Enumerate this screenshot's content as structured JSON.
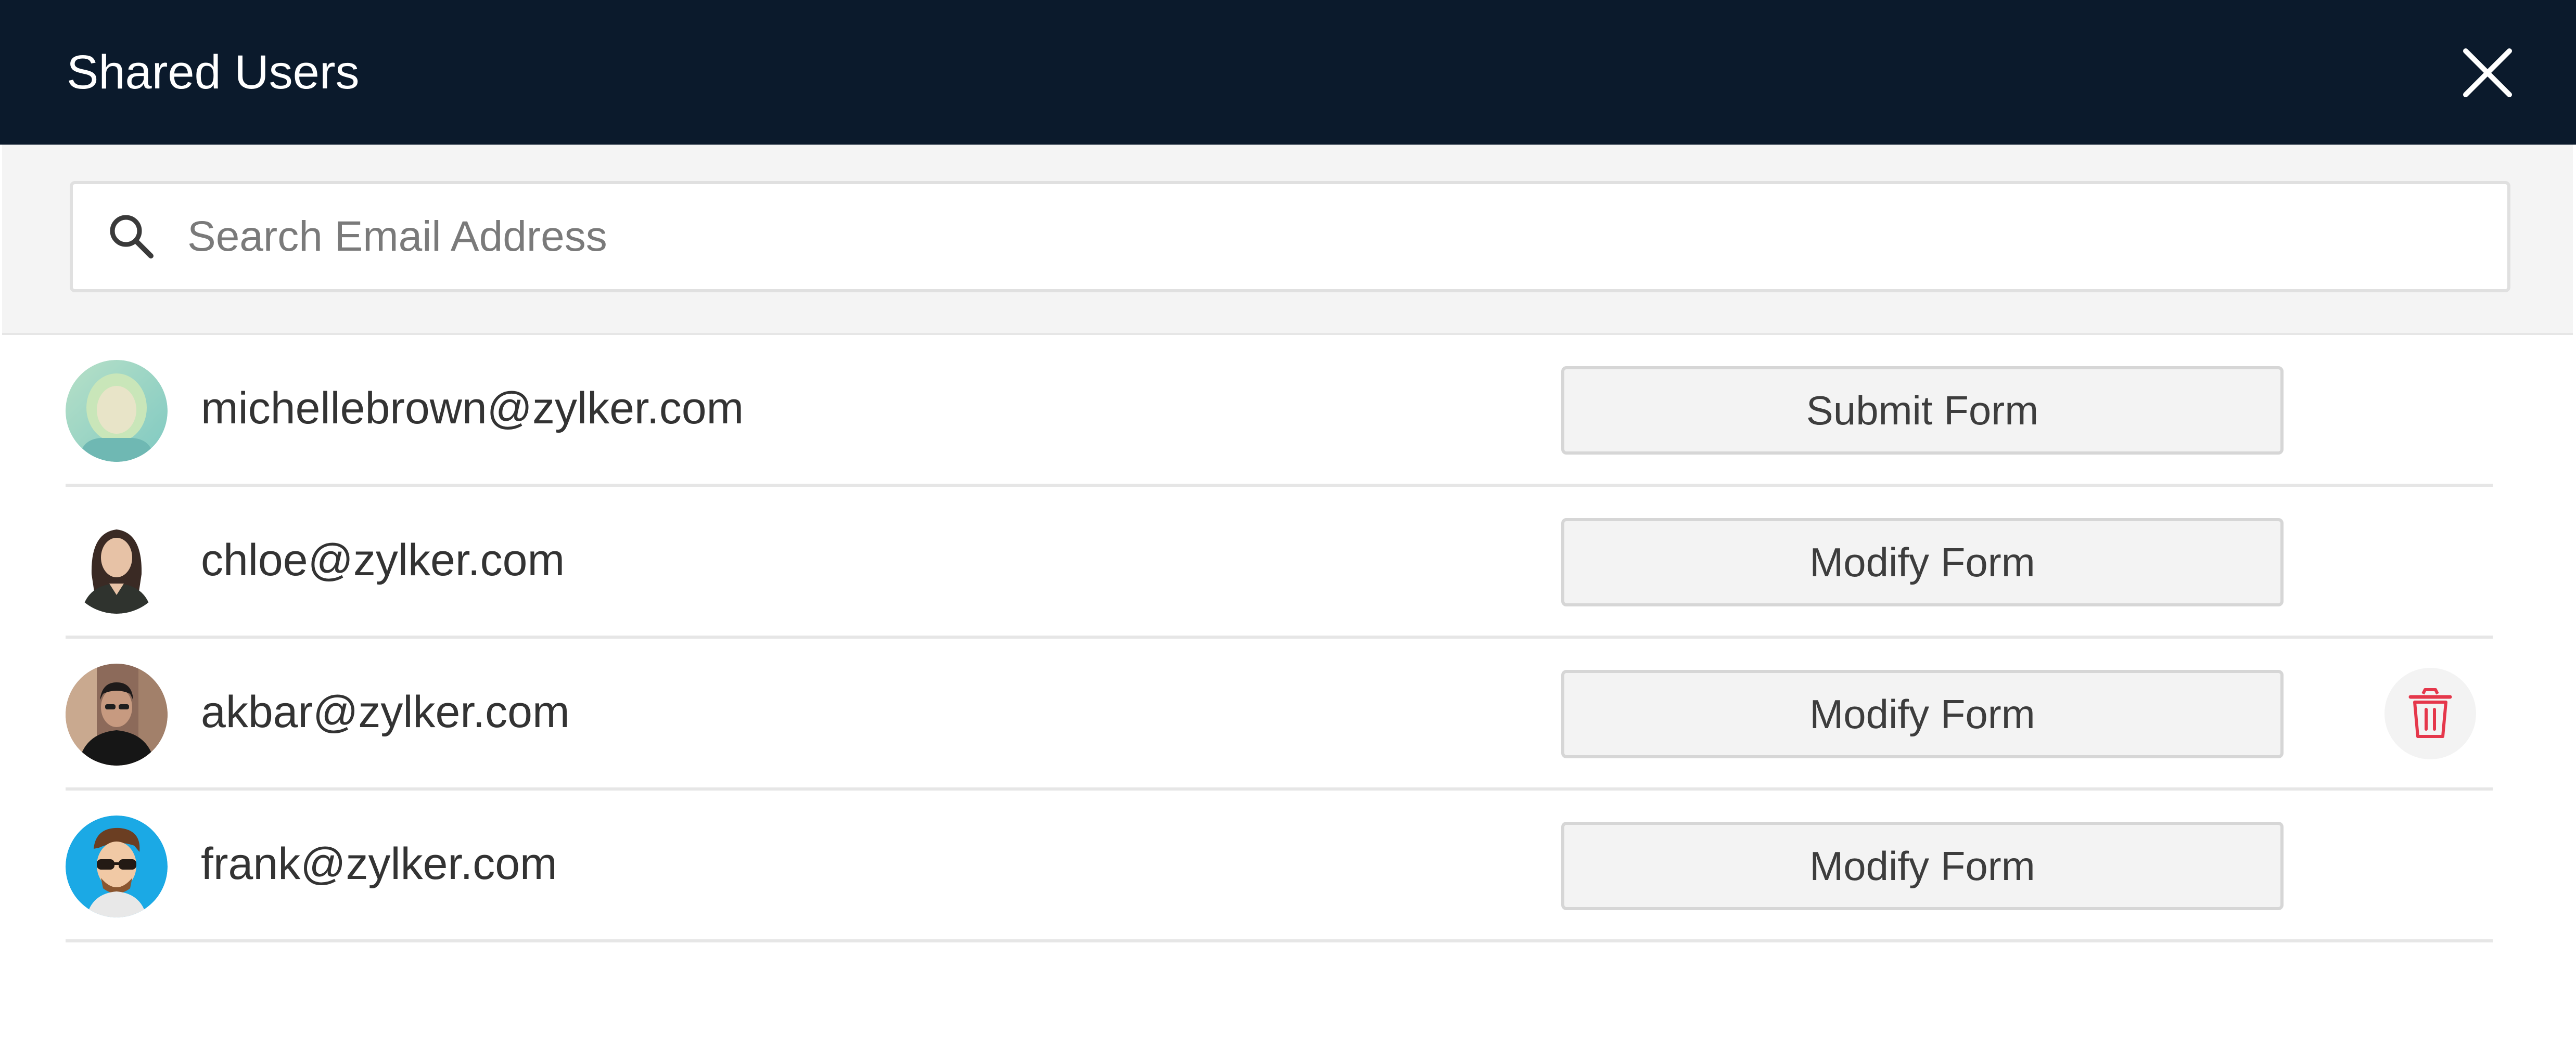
{
  "header": {
    "title": "Shared Users",
    "close_icon": "close-icon"
  },
  "search": {
    "placeholder": "Search Email Address",
    "value": "",
    "icon": "search-icon"
  },
  "users": [
    {
      "email": "michellebrown@zylker.com",
      "permission": "Submit Form",
      "avatar": "avatar-michelle"
    },
    {
      "email": "chloe@zylker.com",
      "permission": "Modify Form",
      "avatar": "avatar-chloe"
    },
    {
      "email": "akbar@zylker.com",
      "permission": "Modify Form",
      "avatar": "avatar-akbar",
      "delete_icon": "trash-icon"
    },
    {
      "email": "frank@zylker.com",
      "permission": "Modify Form",
      "avatar": "avatar-frank"
    }
  ],
  "colors": {
    "header_bg": "#0b1a2c",
    "delete_icon": "#e5374b",
    "divider": "#e6e6e6"
  }
}
